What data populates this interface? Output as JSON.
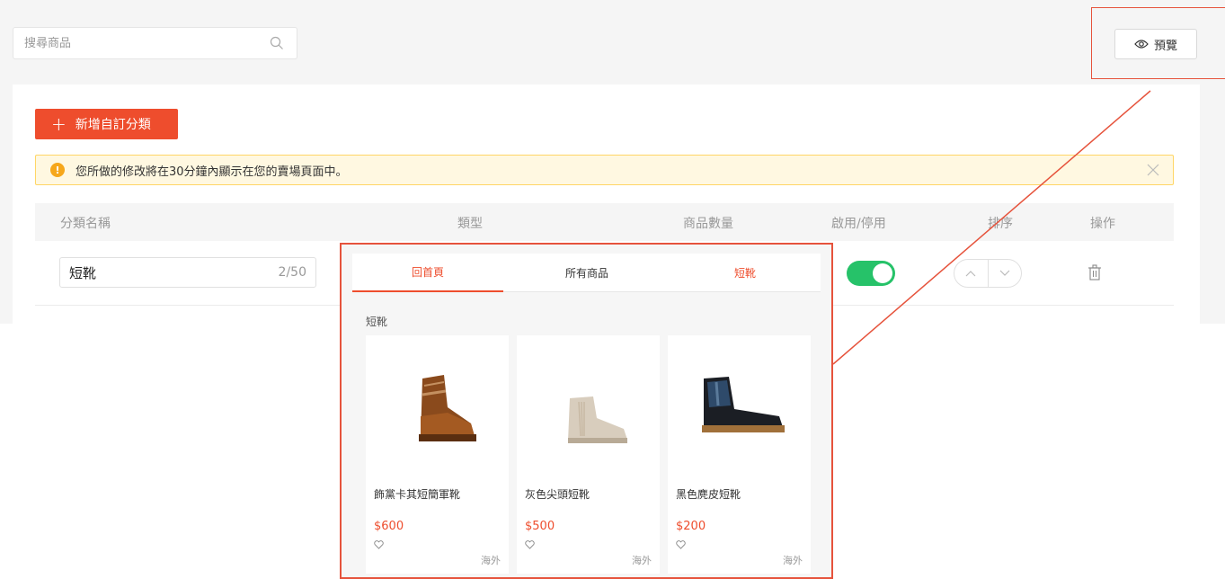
{
  "search": {
    "placeholder": "搜尋商品"
  },
  "preview": {
    "label": "預覽"
  },
  "add_category": {
    "label": "新增自訂分類"
  },
  "notice": {
    "text": "您所做的修改將在30分鐘內顯示在您的賣場頁面中。"
  },
  "table": {
    "headers": {
      "name": "分類名稱",
      "type": "類型",
      "count": "商品數量",
      "enable": "啟用/停用",
      "sort": "排序",
      "action": "操作"
    },
    "rows": [
      {
        "name": "短靴",
        "char_count": "2/50",
        "enabled": true
      }
    ]
  },
  "popup": {
    "tabs": [
      {
        "label": "回首頁"
      },
      {
        "label": "所有商品"
      },
      {
        "label": "短靴"
      }
    ],
    "section_title": "短靴",
    "products": [
      {
        "name": "飾黨卡其短簡軍靴",
        "price": "$600",
        "tag": "海外"
      },
      {
        "name": "灰色尖頭短靴",
        "price": "$500",
        "tag": "海外"
      },
      {
        "name": "黑色麂皮短靴",
        "price": "$200",
        "tag": "海外"
      }
    ]
  },
  "colors": {
    "accent": "#ee4d2d",
    "highlight": "#e6533c",
    "toggle_on": "#26c269",
    "warning_bg": "#fff8e1",
    "warning_border": "#ffd666"
  }
}
